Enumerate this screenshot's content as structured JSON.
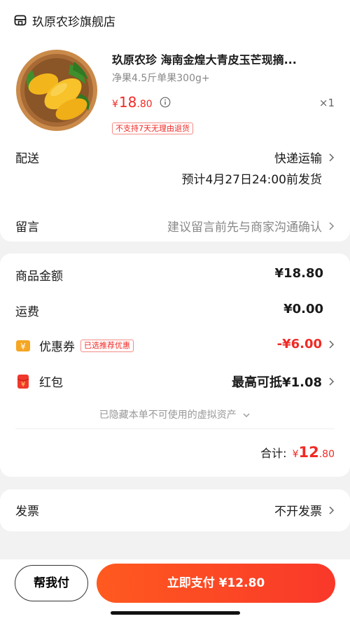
{
  "shop": {
    "name": "玖原农珍旗舰店",
    "icon": "store-icon"
  },
  "product": {
    "title": "玖原农珍 海南金煌大青皮玉芒现摘...",
    "spec": "净果4.5斤单果300g+",
    "price_symbol": "¥",
    "price_int": "18",
    "price_dec": ".80",
    "quantity": "×1",
    "return_tag": "不支持7天无理由退货",
    "image": "mango-basket-image"
  },
  "delivery": {
    "label": "配送",
    "method": "快递运输",
    "eta": "预计4月27日24:00前发货"
  },
  "note": {
    "label": "留言",
    "hint": "建议留言前先与商家沟通确认"
  },
  "amounts": {
    "goods_label": "商品金额",
    "goods_value": "¥18.80",
    "shipping_label": "运费",
    "shipping_value": "¥0.00",
    "coupon_label": "优惠券",
    "coupon_tag": "已选推荐优惠",
    "coupon_value": "-¥6.00",
    "redpacket_label": "红包",
    "redpacket_value": "最高可抵¥1.08",
    "hidden_assets": "已隐藏本单不可使用的虚拟资产",
    "total_label": "合计:",
    "total_symbol": "¥",
    "total_int": "12",
    "total_dec": ".80"
  },
  "invoice": {
    "label": "发票",
    "value": "不开发票"
  },
  "actions": {
    "help_pay": "帮我付",
    "pay_now": "立即支付 ¥12.80"
  },
  "colors": {
    "accent": "#f02a25",
    "pay_gradient_start": "#ff5a1f",
    "pay_gradient_end": "#f9382a",
    "coupon_icon": "#f5a623"
  }
}
